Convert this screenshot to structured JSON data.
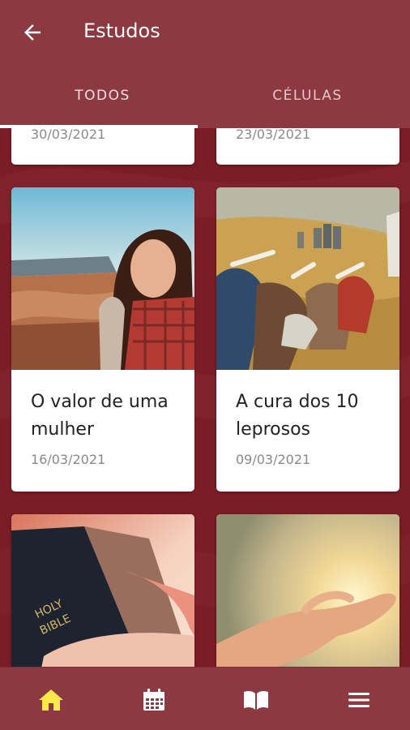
{
  "header": {
    "title": "Estudos",
    "back_icon": "arrow-left-icon"
  },
  "tabs": [
    {
      "label": "TODOS",
      "active": true
    },
    {
      "label": "CÉLULAS",
      "active": false
    }
  ],
  "cards": [
    {
      "title": "",
      "date": "30/03/2021",
      "image": "partial-card-top-left"
    },
    {
      "title": "",
      "date": "23/03/2021",
      "image": "partial-card-top-right"
    },
    {
      "title": "O valor de uma mulher",
      "date": "16/03/2021",
      "image": "woman-smiling-canyon-photo"
    },
    {
      "title": "A cura dos 10 leprosos",
      "date": "09/03/2021",
      "image": "ten-lepers-painting"
    },
    {
      "title": "",
      "date": "",
      "image": "holy-bible-in-hands-photo"
    },
    {
      "title": "",
      "date": "",
      "image": "open-hand-sunlight-photo"
    }
  ],
  "bottom_nav": [
    {
      "icon": "home-icon",
      "active": true
    },
    {
      "icon": "calendar-icon",
      "active": false
    },
    {
      "icon": "book-icon",
      "active": false
    },
    {
      "icon": "menu-icon",
      "active": false
    }
  ],
  "colors": {
    "appbar": "#8c3941",
    "background": "#7b1d26",
    "active_nav": "#ffe94a",
    "inactive_nav": "#ffffff"
  }
}
